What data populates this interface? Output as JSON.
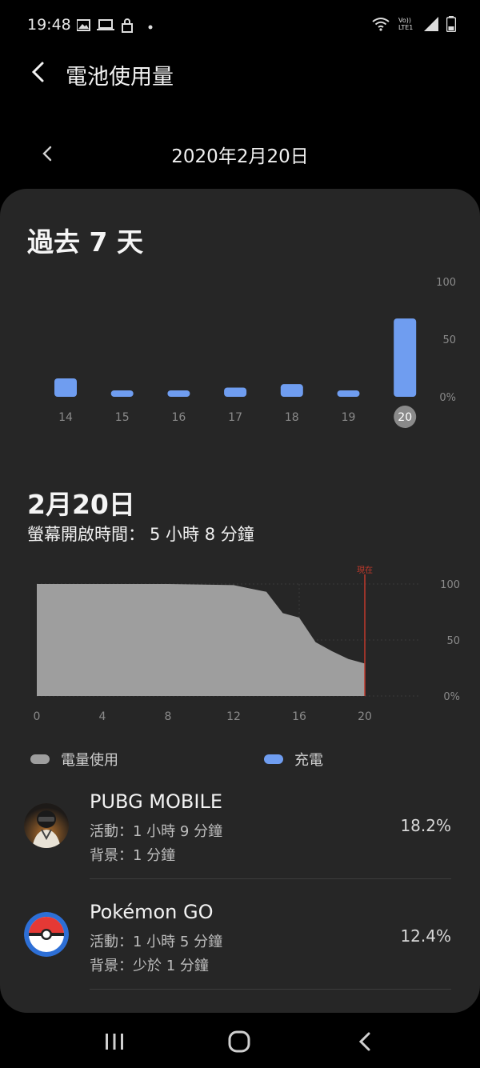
{
  "status_bar": {
    "time": "19:48",
    "left_icons": [
      "gallery-icon",
      "laptop-icon",
      "lock-icon",
      "dot-icon"
    ],
    "right_icons": [
      "wifi-icon",
      "volte-icon",
      "signal-icon",
      "battery-icon"
    ],
    "volte_text": "Vo)) LTE1"
  },
  "header": {
    "title": "電池使用量",
    "back_icon": "chevron-left-icon"
  },
  "date_nav": {
    "date": "2020年2月20日",
    "prev_icon": "chevron-left-icon"
  },
  "week_section": {
    "title": "過去 7 天"
  },
  "day_section": {
    "title": "2月20日",
    "screen_time_label": "螢幕開啟時間：",
    "screen_time_value": "5 小時 8 分鐘"
  },
  "legend": {
    "usage_label": "電量使用",
    "charge_label": "充電",
    "usage_color": "#9e9e9e",
    "charge_color": "#6f9df0"
  },
  "chart_data": [
    {
      "type": "bar",
      "categories": [
        "14",
        "15",
        "16",
        "17",
        "18",
        "19",
        "20"
      ],
      "values": [
        16,
        5,
        4,
        8,
        11,
        4,
        68
      ],
      "selected_category": "20",
      "ylim": [
        0,
        100
      ],
      "yticks": [
        "0%",
        "50",
        "100"
      ],
      "color": "#6f9df0"
    },
    {
      "type": "area",
      "x": [
        0,
        8,
        12,
        13,
        14,
        15,
        16,
        17,
        18,
        19,
        20
      ],
      "values": [
        100,
        100,
        99,
        96,
        93,
        74,
        70,
        48,
        40,
        33,
        29
      ],
      "xticks": [
        "0",
        "4",
        "8",
        "12",
        "16",
        "20"
      ],
      "yticks": [
        "0%",
        "50",
        "100"
      ],
      "xlim": [
        0,
        20
      ],
      "ylim": [
        0,
        100
      ],
      "marker_x": 20,
      "marker_label": "現在",
      "color": "#9e9e9e",
      "marker_color": "#c0392b"
    }
  ],
  "apps": [
    {
      "name": "PUBG MOBILE",
      "active": "活動：1 小時 9 分鐘",
      "background": "背景：1 分鐘",
      "percent": "18.2%",
      "icon": "pubg-app-icon"
    },
    {
      "name": "Pokémon GO",
      "active": "活動：1 小時 5 分鐘",
      "background": "背景：少於 1 分鐘",
      "percent": "12.4%",
      "icon": "pokemon-go-app-icon"
    }
  ],
  "nav_bar": {
    "recents_icon": "recents-icon",
    "home_icon": "home-icon",
    "back_icon": "back-icon"
  }
}
